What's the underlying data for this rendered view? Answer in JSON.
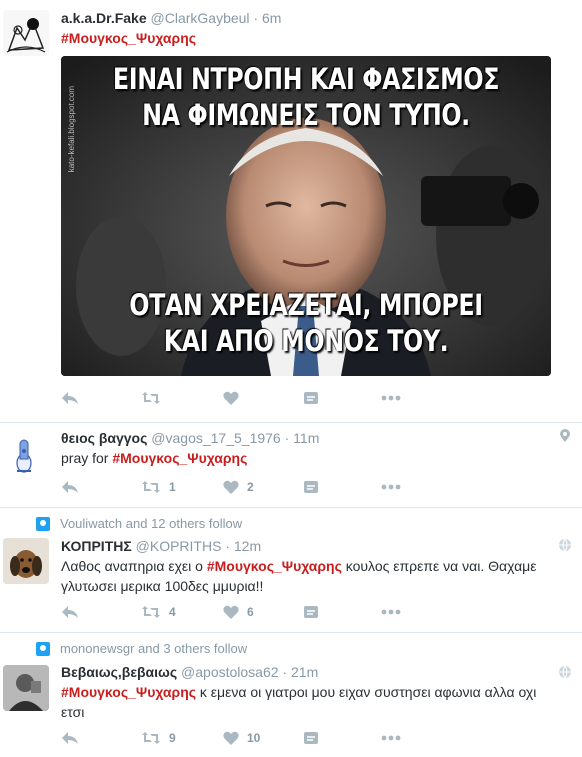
{
  "tweets": [
    {
      "name": "a.k.a.Dr.Fake",
      "handle": "@ClarkGaybeul",
      "time": "6m",
      "hashtag": "#Μουγκος_Ψυχαρης",
      "image_top_caption": "ΕΙΝΑΙ ΝΤΡΟΠΗ ΚΑΙ ΦΑΣΙΣΜΟΣ",
      "image_top_caption_2": "ΝΑ ΦΙΜΩΝΕΙΣ ΤΟΝ ΤΥΠΟ.",
      "image_bottom_caption": "ΟΤΑΝ ΧΡΕΙΑΖΕΤΑΙ, ΜΠΟΡΕΙ",
      "image_bottom_caption_2": "ΚΑΙ ΑΠΟ ΜΟΝΟΣ ΤΟΥ.",
      "image_credit": "kato-kefali.blogspot.com"
    },
    {
      "name": "θειος βαγγος",
      "handle": "@vagos_17_5_1976",
      "time": "11m",
      "text_prefix": "pray for ",
      "hashtag": "#Μουγκος_Ψυχαρης",
      "retweets": "1",
      "likes": "2"
    },
    {
      "context": "Vouliwatch and 12 others follow",
      "name": "ΚΟΠΡΙΤΗΣ",
      "handle": "@KOPRITHS",
      "time": "12m",
      "text_prefix": "Λαθος αναπηρια εχει ο ",
      "hashtag": "#Μουγκος_Ψυχαρης",
      "text_suffix": " κουλος επρεπε να ναι. Θαχαμε",
      "text_line2": "γλυτωσει μερικα 100δες μμυρια!!",
      "retweets": "4",
      "likes": "6"
    },
    {
      "context": "mononewsgr and 3 others follow",
      "name": "Βεβαιως,βεβαιως",
      "handle": "@apostolosa62",
      "time": "21m",
      "hashtag": "#Μουγκος_Ψυχαρης",
      "text_suffix": "  κ εμενα οι γιατροι μου ειχαν συστησει αφωνια αλλα οχι",
      "text_line2": "ετσι",
      "retweets": "9",
      "likes": "10"
    }
  ],
  "dot": "·",
  "colors": {
    "hashtag": "#c91e1e",
    "meta": "#8899a6",
    "icon": "#aab8c2",
    "accent": "#1da1f2"
  },
  "icons": [
    "reply-icon",
    "retweet-icon",
    "like-icon",
    "dm-icon",
    "more-icon",
    "location-icon",
    "follow-context-icon",
    "globe-icon"
  ]
}
